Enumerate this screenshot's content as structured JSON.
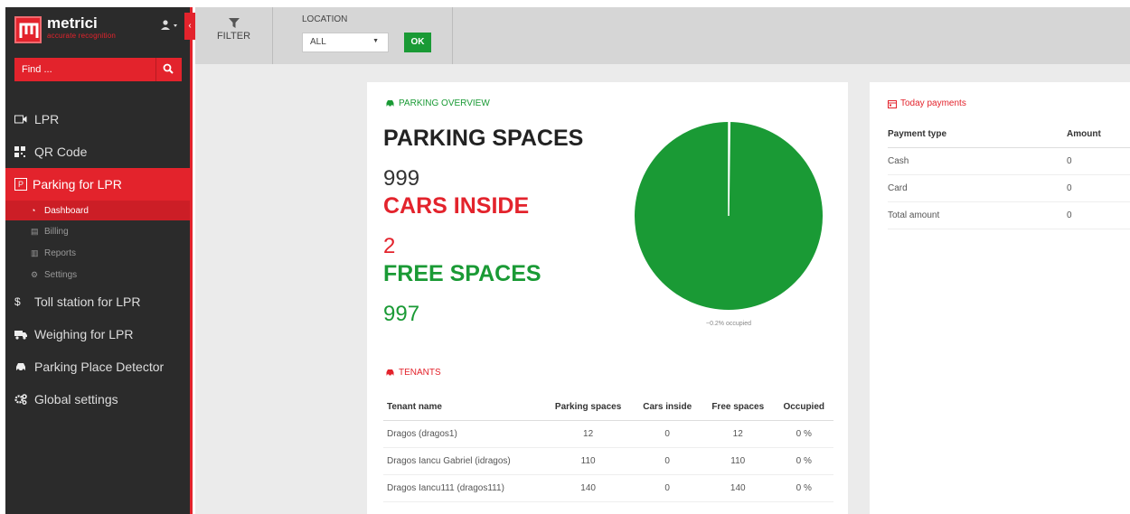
{
  "app": {
    "name": "metrici",
    "tagline": "accurate recognition"
  },
  "search": {
    "placeholder": "Find ..."
  },
  "nav": {
    "lpr": "LPR",
    "qr": "QR Code",
    "parking": "Parking for LPR",
    "sub": {
      "dashboard": "Dashboard",
      "billing": "Billing",
      "reports": "Reports",
      "settings": "Settings"
    },
    "toll": "Toll station for LPR",
    "weighing": "Weighing for LPR",
    "ppd": "Parking Place Detector",
    "global": "Global settings"
  },
  "toolbar": {
    "filter": "FILTER",
    "location_label": "LOCATION",
    "location_value": "ALL",
    "ok": "OK"
  },
  "overview": {
    "title": "PARKING OVERVIEW",
    "spaces_label": "PARKING SPACES",
    "spaces_value": "999",
    "inside_label": "CARS INSIDE",
    "inside_value": "2",
    "free_label": "FREE SPACES",
    "free_value": "997",
    "occupied_caption": "~0.2% occupied",
    "occupied_fraction": 0.002
  },
  "tenants": {
    "title": "TENANTS",
    "headers": [
      "Tenant name",
      "Parking spaces",
      "Cars inside",
      "Free spaces",
      "Occupied"
    ],
    "rows": [
      [
        "Dragos (dragos1)",
        "12",
        "0",
        "12",
        "0 %"
      ],
      [
        "Dragos Iancu Gabriel (idragos)",
        "110",
        "0",
        "110",
        "0 %"
      ],
      [
        "Dragos Iancu111 (dragos111)",
        "140",
        "0",
        "140",
        "0 %"
      ]
    ]
  },
  "payments": {
    "title": "Today payments",
    "headers": [
      "Payment type",
      "Amount"
    ],
    "rows": [
      [
        "Cash",
        "0"
      ],
      [
        "Card",
        "0"
      ],
      [
        "Total amount",
        "0"
      ]
    ]
  },
  "colors": {
    "accent": "#e3232c",
    "green": "#1a9a35",
    "sidebar": "#2b2b2b"
  }
}
